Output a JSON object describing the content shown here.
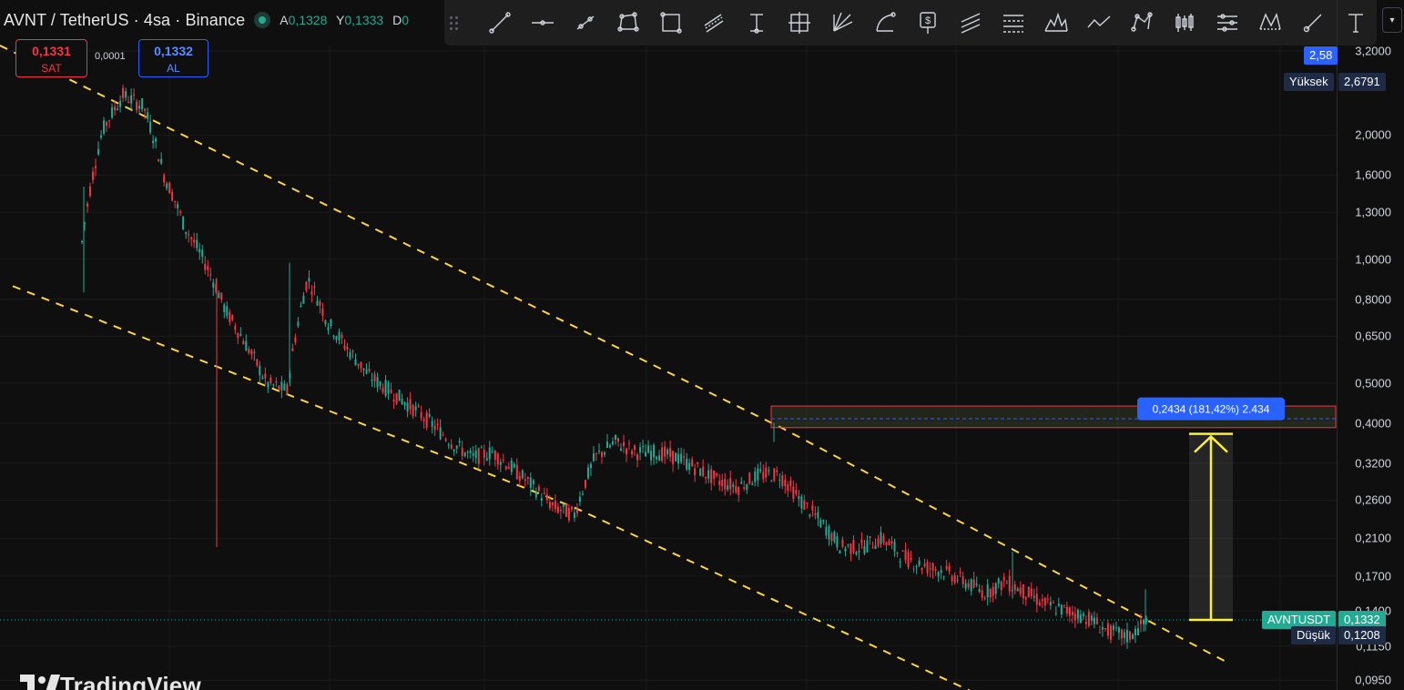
{
  "header": {
    "symbol": "AVNT / TetherUS · 4sa · Binance",
    "ohlc": [
      {
        "k": "A",
        "v": "0,1328"
      },
      {
        "k": "Y",
        "v": "0,1333"
      },
      {
        "k": "D",
        "v": "0"
      }
    ]
  },
  "trade": {
    "sell_price": "0,1331",
    "sell_label": "SAT",
    "spread": "0,0001",
    "buy_price": "0,1332",
    "buy_label": "AL"
  },
  "toolbar": {
    "tools": [
      "trend-line-icon",
      "horizontal-ray-icon",
      "info-line-icon",
      "path-icon",
      "rectangle-icon",
      "parallel-channel-icon",
      "vertical-ruler-icon",
      "crosshair-box-icon",
      "gann-fan-icon",
      "arc-icon",
      "price-label-icon",
      "parallel-lines-icon",
      "fib-levels-icon",
      "pattern-icon",
      "zigzag-icon",
      "polygon-icon",
      "candles-icon",
      "settings-lines-icon",
      "xabcd-icon",
      "brush-icon",
      "text-icon"
    ],
    "dropdown_icon": "chevron-down-icon"
  },
  "chart_data": {
    "type": "candlestick",
    "y_scale": "log",
    "ylim": [
      0.09,
      3.3
    ],
    "y_ticks": [
      "3,2000",
      "2,0000",
      "1,6000",
      "1,3000",
      "1,0000",
      "0,8000",
      "0,6500",
      "0,5000",
      "0,4000",
      "0,3200",
      "0,2600",
      "0,2100",
      "0,1700",
      "0,1400",
      "0,1150",
      "0,0950"
    ],
    "close_path": [
      [
        0.94,
        1.1
      ],
      [
        1.45,
        2.05
      ],
      [
        1.9,
        2.5
      ],
      [
        1.4,
        2.35
      ],
      [
        1.2,
        1.6
      ],
      [
        1.05,
        1.2
      ],
      [
        1.0,
        0.98
      ],
      [
        0.85,
        0.75
      ],
      [
        0.7,
        0.62
      ],
      [
        0.6,
        0.5
      ],
      [
        0.52,
        0.48
      ],
      [
        0.75,
        0.9
      ],
      [
        0.85,
        0.7
      ],
      [
        0.7,
        0.6
      ],
      [
        0.6,
        0.52
      ],
      [
        0.55,
        0.48
      ],
      [
        0.5,
        0.44
      ],
      [
        0.44,
        0.4
      ],
      [
        0.4,
        0.36
      ],
      [
        0.36,
        0.33
      ],
      [
        0.34,
        0.34
      ],
      [
        0.33,
        0.31
      ],
      [
        0.3,
        0.28
      ],
      [
        0.27,
        0.25
      ],
      [
        0.25,
        0.24
      ],
      [
        0.3,
        0.33
      ],
      [
        0.35,
        0.36
      ],
      [
        0.37,
        0.34
      ],
      [
        0.35,
        0.34
      ],
      [
        0.34,
        0.33
      ],
      [
        0.33,
        0.31
      ],
      [
        0.31,
        0.29
      ],
      [
        0.29,
        0.28
      ],
      [
        0.3,
        0.3
      ],
      [
        0.32,
        0.3
      ],
      [
        0.3,
        0.26
      ],
      [
        0.26,
        0.23
      ],
      [
        0.23,
        0.2
      ],
      [
        0.2,
        0.2
      ],
      [
        0.2,
        0.21
      ],
      [
        0.2,
        0.19
      ],
      [
        0.19,
        0.18
      ],
      [
        0.18,
        0.175
      ],
      [
        0.175,
        0.165
      ],
      [
        0.16,
        0.155
      ],
      [
        0.16,
        0.165
      ],
      [
        0.16,
        0.155
      ],
      [
        0.15,
        0.145
      ],
      [
        0.145,
        0.14
      ],
      [
        0.14,
        0.135
      ],
      [
        0.133,
        0.125
      ],
      [
        0.125,
        0.121
      ],
      [
        0.124,
        0.1332
      ]
    ],
    "wicks": [
      {
        "high": 1.5,
        "low": 0.83
      },
      {
        "high": 0.9,
        "low": 0.2
      },
      {
        "high": 0.98,
        "low": 0.5
      },
      {
        "high": 0.4,
        "low": 0.36
      },
      {
        "high": 0.195,
        "low": 0.15
      },
      {
        "high": 0.158,
        "low": 0.125
      }
    ],
    "highest": "2,6791",
    "lowest": "0,1208",
    "last_price": "0,1332",
    "top_badge": "2,58",
    "target_zone": {
      "low": 0.39,
      "high": 0.44,
      "mid": 0.41
    },
    "measure": {
      "from": 0.1332,
      "to": 0.3766,
      "label": "0,2434 (181,42%) 2.434"
    },
    "channel": {
      "upper": [
        [
          0.0,
          3.3
        ],
        [
          0.54,
          0.39
        ],
        [
          0.86,
          0.105
        ]
      ],
      "lower": [
        [
          0.0,
          0.86
        ],
        [
          0.4,
          0.25
        ],
        [
          0.69,
          0.087
        ]
      ]
    },
    "labels": {
      "high": "Yüksek",
      "low": "Düşük",
      "symbol": "AVNTUSDT"
    }
  },
  "colors": {
    "up": "#22ab94",
    "down": "#f23645",
    "channel": "#fbd545",
    "measure": "#fbf03f",
    "accent": "#2962ff"
  },
  "watermark": "TradingView"
}
